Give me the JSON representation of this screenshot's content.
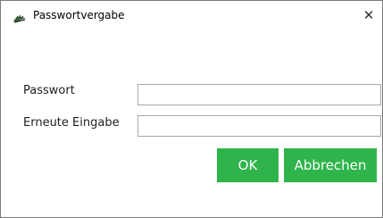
{
  "window": {
    "title": "Passwortvergabe",
    "close_glyph": "✕",
    "icon": "app-leaf-icon"
  },
  "form": {
    "password_label": "Passwort",
    "password_value": "",
    "confirm_label": "Erneute Eingabe",
    "confirm_value": ""
  },
  "buttons": {
    "ok_label": "OK",
    "cancel_label": "Abbrechen",
    "accent_color": "#2fb44b"
  }
}
